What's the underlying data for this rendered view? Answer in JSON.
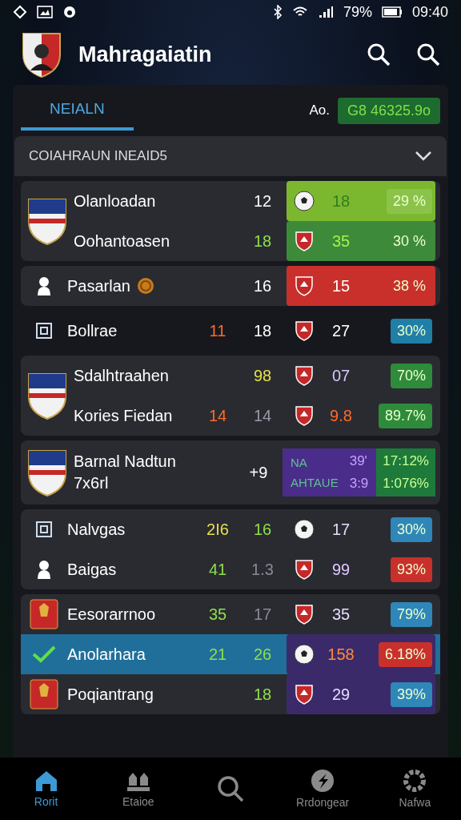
{
  "status_bar": {
    "time": "09:40",
    "battery": "79%"
  },
  "header": {
    "title": "Mahragaiatin"
  },
  "tabs": [
    {
      "label": "NEIALN",
      "selected": true
    }
  ],
  "summary": {
    "label": "Ao.",
    "value": "G8 46325.9o"
  },
  "dropdown": {
    "label": "COIAHRAUN INEAID5",
    "expanded": false
  },
  "cards": [
    {
      "rows": [
        {
          "kind": "single",
          "name": "Olanloadan",
          "c2": {
            "text": "12",
            "color": "#ffffff"
          },
          "c3": {
            "text": "18",
            "color": "#2f7d1f"
          },
          "pct": {
            "text": "29 %",
            "color": "#8bc34a"
          },
          "color": "#7cb82f",
          "selected": false
        },
        {
          "kind": "single",
          "name": "Oohantoasen",
          "c2": {
            "text": "18",
            "color": "#8ee04a"
          },
          "c3": {
            "text": "35",
            "color": "#a6f04a"
          },
          "pct": {
            "text": "30 %",
            "color": "#3d8a3a"
          },
          "color": "#3d8a3a",
          "selected": false
        }
      ]
    },
    {
      "rows": [
        {
          "kind": "single",
          "name": "Pasarlan",
          "c2": {
            "text": "16",
            "color": "#ffffff"
          },
          "c3": {
            "text": "15",
            "color": "#ffffff"
          },
          "pct": {
            "text": "38 %",
            "color": "#c9302c"
          },
          "color": "#c9302c",
          "selected": false
        }
      ]
    },
    {
      "rows": [
        {
          "kind": "single",
          "name": "Bollrae",
          "c1": {
            "text": "11",
            "color": "#ff6a2a"
          },
          "c2": {
            "text": "18",
            "color": "#ffffff"
          },
          "c3": {
            "text": "27",
            "color": "#ffffff"
          },
          "pct": {
            "text": "30%",
            "color": "#1f7fa6"
          },
          "selected": false
        }
      ]
    },
    {
      "rows": [
        {
          "kind": "single",
          "name": "Sdalhtraahen",
          "c2": {
            "text": "98",
            "color": "#e6e04a"
          },
          "c3": {
            "text": "07",
            "color": "#d9c6ff"
          },
          "pct": {
            "text": "70%",
            "color": "#2e8b3a"
          },
          "selected": false
        },
        {
          "kind": "single",
          "name": "Kories Fiedan",
          "c1": {
            "text": "14",
            "color": "#ff6a2a"
          },
          "c2": {
            "text": "14",
            "color": "#9a9aa6"
          },
          "c3": {
            "text": "9.8",
            "color": "#ff6a2a"
          },
          "pct": {
            "text": "89.7%",
            "color": "#2e8b3a"
          },
          "selected": false
        }
      ]
    },
    {
      "rows": [
        {
          "kind": "split",
          "name": "Barnal Nadtun",
          "name_2": "7x6rl",
          "c2": {
            "text": "+9",
            "color": "#ffffff"
          },
          "band_labels": [
            "NA",
            "AHTAUE"
          ],
          "band_values": [
            "39'",
            "3:9"
          ],
          "pcts": [
            "17:12%",
            "1:076%"
          ],
          "color": "#4a2d8a",
          "selected": false
        }
      ]
    },
    {
      "rows": [
        {
          "kind": "single",
          "name": "Nalvgas",
          "c1": {
            "text": "2I6",
            "color": "#e6e04a"
          },
          "c2": {
            "text": "16",
            "color": "#8ee04a"
          },
          "c3": {
            "text": "17",
            "color": "#e6dcff"
          },
          "pct": {
            "text": "30%",
            "color": "#2f86b8"
          },
          "selected": false
        },
        {
          "kind": "single",
          "name": "Baigas",
          "c1": {
            "text": "41",
            "color": "#8ee04a"
          },
          "c2": {
            "text": "1.3",
            "color": "#8a8a96"
          },
          "c3": {
            "text": "99",
            "color": "#e0c8ff"
          },
          "pct": {
            "text": "93%",
            "color": "#c9302c"
          },
          "selected": false
        }
      ]
    },
    {
      "rows": [
        {
          "kind": "single",
          "name": "Eesorarrnoo",
          "c1": {
            "text": "35",
            "color": "#8ee04a"
          },
          "c2": {
            "text": "17",
            "color": "#8a8a96"
          },
          "c3": {
            "text": "35",
            "color": "#e6dcff"
          },
          "pct": {
            "text": "79%",
            "color": "#2f86b8"
          },
          "selected": false
        },
        {
          "kind": "single",
          "name": "Anolarhara",
          "c1": {
            "text": "21",
            "color": "#8ee04a"
          },
          "c2": {
            "text": "26",
            "color": "#8ee04a"
          },
          "c3": {
            "text": "158",
            "color": "#ff8a3a"
          },
          "pct": {
            "text": "6.18%",
            "color": "#c9302c"
          },
          "color": "#3a2a6a",
          "selected": true
        },
        {
          "kind": "single",
          "name": "Poqiantrang",
          "c2": {
            "text": "18",
            "color": "#8ee04a"
          },
          "c3": {
            "text": "29",
            "color": "#e6dcff"
          },
          "pct": {
            "text": "39%",
            "color": "#2f86b8"
          },
          "color": "#3a2a6a",
          "selected": false
        }
      ]
    }
  ],
  "nav": [
    {
      "label": "Rorit",
      "selected": true
    },
    {
      "label": "Etaioe",
      "selected": false
    },
    {
      "selected": false
    },
    {
      "label": "Rrdongear",
      "selected": false
    },
    {
      "label": "Nafwa",
      "selected": false
    }
  ]
}
